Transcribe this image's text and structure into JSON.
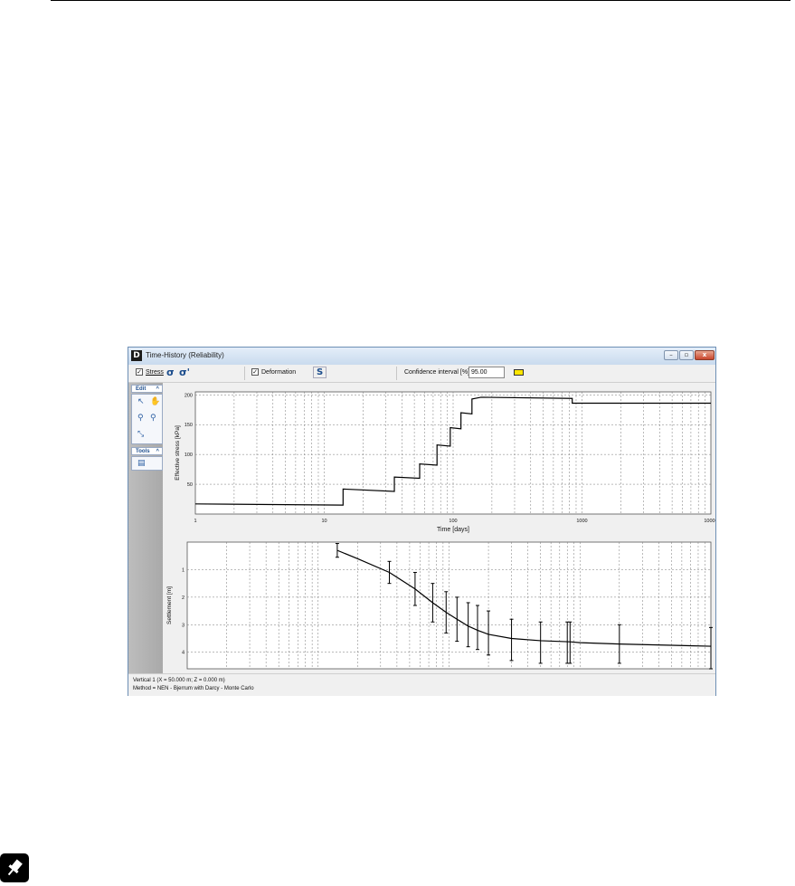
{
  "window": {
    "title": "Time-History (Reliability)",
    "app_icon": "D",
    "buttons": {
      "minimize": "–",
      "maximize": "▫",
      "close": "x"
    }
  },
  "toolbar": {
    "stress_label": "Stress",
    "stress_checked": true,
    "sigma_icon": "σ",
    "sigma_prime_icon": "σ'",
    "deformation_label": "Deformation",
    "deformation_checked": true,
    "deformation_icon": "S",
    "confidence_label": "Confidence interval [%]",
    "confidence_value": "95.00"
  },
  "side_panels": {
    "edit": {
      "label": "Edit",
      "tools": [
        "select-arrow-icon",
        "pan-hand-icon",
        "zoom-in-icon",
        "zoom-out-icon",
        "zoom-window-icon"
      ]
    },
    "tools": {
      "label": "Tools",
      "tools": [
        "export-chart-icon"
      ]
    }
  },
  "chart_data": [
    {
      "type": "line",
      "step": true,
      "xscale": "log",
      "xlim": [
        1,
        10000
      ],
      "ylim": [
        0,
        205
      ],
      "xlabel": "Time [days]",
      "ylabel": "Effective stress [kPa]",
      "xticks": [
        1,
        10,
        100,
        1000,
        10000
      ],
      "xtick_labels": [
        "1",
        "10",
        "100",
        "1000",
        "10000"
      ],
      "yticks": [
        50,
        100,
        150,
        200
      ],
      "ytick_labels": [
        "50",
        "100",
        "150",
        "200"
      ],
      "grid": true,
      "x": [
        1,
        14,
        14,
        35,
        35,
        55,
        55,
        75,
        75,
        95,
        95,
        115,
        115,
        140,
        140,
        165,
        165,
        840,
        840,
        10000
      ],
      "y": [
        17,
        15,
        42,
        38,
        62,
        60,
        84,
        82,
        116,
        114,
        145,
        143,
        170,
        168,
        193,
        196,
        196,
        194,
        186,
        186
      ]
    },
    {
      "type": "line",
      "xscale": "log",
      "xlim": [
        1,
        10000
      ],
      "ylim": [
        0,
        4.6
      ],
      "yreversed": true,
      "xlabel": "",
      "ylabel": "Settlement [m]",
      "xticks": [
        1,
        10,
        100,
        1000,
        10000
      ],
      "xtick_labels": [
        "1",
        "10",
        "100",
        "1000",
        "10000"
      ],
      "yticks": [
        1,
        2,
        3,
        4
      ],
      "ytick_labels": [
        "1",
        "2",
        "3",
        "4"
      ],
      "grid": true,
      "x": [
        14,
        20,
        35,
        55,
        75,
        95,
        115,
        140,
        165,
        200,
        300,
        500,
        840,
        1000,
        2000,
        10000
      ],
      "y": [
        0.3,
        0.6,
        1.1,
        1.7,
        2.2,
        2.55,
        2.8,
        3.05,
        3.2,
        3.35,
        3.5,
        3.58,
        3.62,
        3.65,
        3.7,
        3.78
      ],
      "error_bars": [
        {
          "x": 14,
          "low": 0.05,
          "high": 0.55
        },
        {
          "x": 35,
          "low": 0.7,
          "high": 1.5
        },
        {
          "x": 55,
          "low": 1.1,
          "high": 2.3
        },
        {
          "x": 75,
          "low": 1.5,
          "high": 2.9
        },
        {
          "x": 95,
          "low": 1.8,
          "high": 3.3
        },
        {
          "x": 115,
          "low": 2.0,
          "high": 3.6
        },
        {
          "x": 140,
          "low": 2.2,
          "high": 3.8
        },
        {
          "x": 165,
          "low": 2.3,
          "high": 3.9
        },
        {
          "x": 200,
          "low": 2.5,
          "high": 4.1
        },
        {
          "x": 300,
          "low": 2.8,
          "high": 4.3
        },
        {
          "x": 500,
          "low": 2.9,
          "high": 4.4
        },
        {
          "x": 800,
          "low": 2.9,
          "high": 4.4
        },
        {
          "x": 840,
          "low": 2.9,
          "high": 4.4
        },
        {
          "x": 2000,
          "low": 3.0,
          "high": 4.4
        },
        {
          "x": 10000,
          "low": 3.1,
          "high": 4.6
        }
      ]
    }
  ],
  "status": {
    "line1": "Vertical 1 (X = 50.000 m; Z = 0.000 m)",
    "line2": "Method = NEN - Bjerrum with Darcy - Monte Carlo"
  }
}
